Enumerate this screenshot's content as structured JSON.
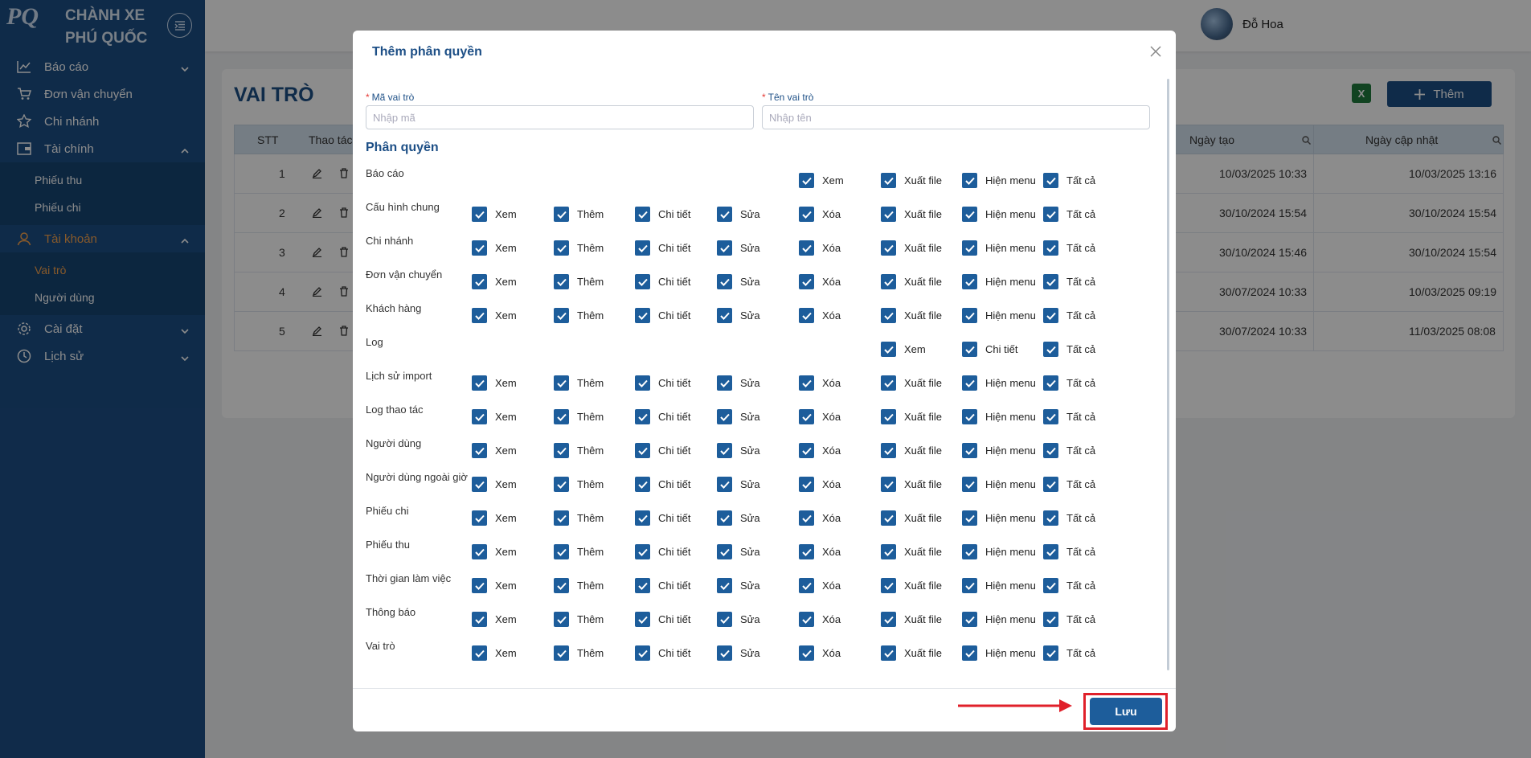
{
  "brand": {
    "line1": "CHÀNH XE",
    "line2": "PHÚ QUỐC",
    "logo": "PQ"
  },
  "nav": {
    "bao_cao": "Báo cáo",
    "don_van_chuyen": "Đơn vận chuyển",
    "chi_nhanh": "Chi nhánh",
    "tai_chinh": "Tài chính",
    "phieu_thu": "Phiếu thu",
    "phieu_chi": "Phiếu chi",
    "tai_khoan": "Tài khoản",
    "vai_tro": "Vai trò",
    "nguoi_dung": "Người dùng",
    "cai_dat": "Cài đặt",
    "lich_su": "Lịch sử"
  },
  "user": {
    "name": "Đỗ Hoa"
  },
  "page": {
    "title": "VAI TRÒ",
    "add_label": "Thêm",
    "excel_label": "X"
  },
  "table": {
    "headers": {
      "stt": "STT",
      "actions": "Thao tác",
      "created": "Ngày tạo",
      "updated": "Ngày cập nhật"
    },
    "rows": [
      {
        "stt": "1",
        "created": "10/03/2025 10:33",
        "updated": "10/03/2025 13:16"
      },
      {
        "stt": "2",
        "created": "30/10/2024 15:54",
        "updated": "30/10/2024 15:54"
      },
      {
        "stt": "3",
        "created": "30/10/2024 15:46",
        "updated": "30/10/2024 15:54"
      },
      {
        "stt": "4",
        "created": "30/07/2024 10:33",
        "updated": "10/03/2025 09:19"
      },
      {
        "stt": "5",
        "created": "30/07/2024 10:33",
        "updated": "11/03/2025 08:08"
      }
    ]
  },
  "modal": {
    "title": "Thêm phân quyền",
    "code_label": "Mã vai trò",
    "code_placeholder": "Nhập mã",
    "name_label": "Tên vai trò",
    "name_placeholder": "Nhập tên",
    "section": "Phân quyền",
    "save": "Lưu",
    "perms": {
      "xem": "Xem",
      "them": "Thêm",
      "chi_tiet": "Chi tiết",
      "sua": "Sửa",
      "xoa": "Xóa",
      "xuat_file": "Xuất file",
      "hien_menu": "Hiện menu",
      "tat_ca": "Tất cả"
    },
    "rows": [
      {
        "name": "Báo cáo"
      },
      {
        "name": "Cấu hình chung"
      },
      {
        "name": "Chi nhánh"
      },
      {
        "name": "Đơn vận chuyển"
      },
      {
        "name": "Khách hàng"
      },
      {
        "name": "Log"
      },
      {
        "name": "Lịch sử import"
      },
      {
        "name": "Log thao tác"
      },
      {
        "name": "Người dùng"
      },
      {
        "name": "Người dùng ngoài giờ"
      },
      {
        "name": "Phiếu chi"
      },
      {
        "name": "Phiếu thu"
      },
      {
        "name": "Thời gian làm việc"
      },
      {
        "name": "Thông báo"
      },
      {
        "name": "Vai trò"
      }
    ]
  }
}
